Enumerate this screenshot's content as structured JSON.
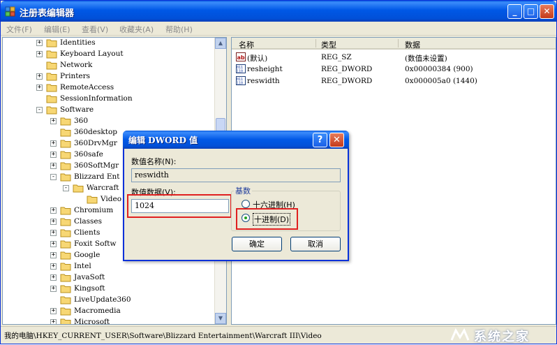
{
  "window": {
    "title": "注册表编辑器",
    "minimize": "_",
    "maximize": "□",
    "close": "✕"
  },
  "menu": [
    "文件(F)",
    "编辑(E)",
    "查看(V)",
    "收藏夹(A)",
    "帮助(H)"
  ],
  "tree": [
    {
      "label": "Identities",
      "exp": "+",
      "level": 0
    },
    {
      "label": "Keyboard Layout",
      "exp": "+",
      "level": 0
    },
    {
      "label": "Network",
      "exp": "",
      "level": 0
    },
    {
      "label": "Printers",
      "exp": "+",
      "level": 0
    },
    {
      "label": "RemoteAccess",
      "exp": "+",
      "level": 0
    },
    {
      "label": "SessionInformation",
      "exp": "",
      "level": 0
    },
    {
      "label": "Software",
      "exp": "-",
      "level": 0
    },
    {
      "label": "360",
      "exp": "+",
      "level": 1
    },
    {
      "label": "360desktop",
      "exp": "",
      "level": 1
    },
    {
      "label": "360DrvMgr",
      "exp": "+",
      "level": 1
    },
    {
      "label": "360safe",
      "exp": "+",
      "level": 1
    },
    {
      "label": "360SoftMgr",
      "exp": "+",
      "level": 1
    },
    {
      "label": "Blizzard Ent",
      "exp": "-",
      "level": 1
    },
    {
      "label": "Warcraft",
      "exp": "-",
      "level": 2
    },
    {
      "label": "Video",
      "exp": "",
      "level": 3
    },
    {
      "label": "Chromium",
      "exp": "+",
      "level": 1
    },
    {
      "label": "Classes",
      "exp": "+",
      "level": 1
    },
    {
      "label": "Clients",
      "exp": "+",
      "level": 1
    },
    {
      "label": "Foxit Softw",
      "exp": "+",
      "level": 1
    },
    {
      "label": "Google",
      "exp": "+",
      "level": 1
    },
    {
      "label": "Intel",
      "exp": "+",
      "level": 1
    },
    {
      "label": "JavaSoft",
      "exp": "+",
      "level": 1
    },
    {
      "label": "Kingsoft",
      "exp": "+",
      "level": 1
    },
    {
      "label": "LiveUpdate360",
      "exp": "",
      "level": 1
    },
    {
      "label": "Macromedia",
      "exp": "+",
      "level": 1
    },
    {
      "label": "Microsoft",
      "exp": "+",
      "level": 1
    }
  ],
  "list": {
    "headers": {
      "name": "名称",
      "type": "类型",
      "data": "数据"
    },
    "rows": [
      {
        "icon": "string-value-icon",
        "name": "(默认)",
        "type": "REG_SZ",
        "data": "(数值未设置)"
      },
      {
        "icon": "binary-value-icon",
        "name": "resheight",
        "type": "REG_DWORD",
        "data": "0x00000384 (900)"
      },
      {
        "icon": "binary-value-icon",
        "name": "reswidth",
        "type": "REG_DWORD",
        "data": "0x000005a0 (1440)"
      }
    ]
  },
  "status": "我的电脑\\HKEY_CURRENT_USER\\Software\\Blizzard Entertainment\\Warcraft III\\Video",
  "watermark": "系统之家",
  "dialog": {
    "title": "编辑 DWORD 值",
    "help": "?",
    "close": "✕",
    "name_label": "数值名称(N):",
    "name_value": "reswidth",
    "data_label": "数值数据(V):",
    "data_value": "1024",
    "base_label": "基数",
    "hex_label": "十六进制(H)",
    "dec_label": "十进制(D)",
    "ok": "确定",
    "cancel": "取消"
  },
  "colors": {
    "highlight": "#e02020",
    "titlebar": "#0058e6"
  }
}
